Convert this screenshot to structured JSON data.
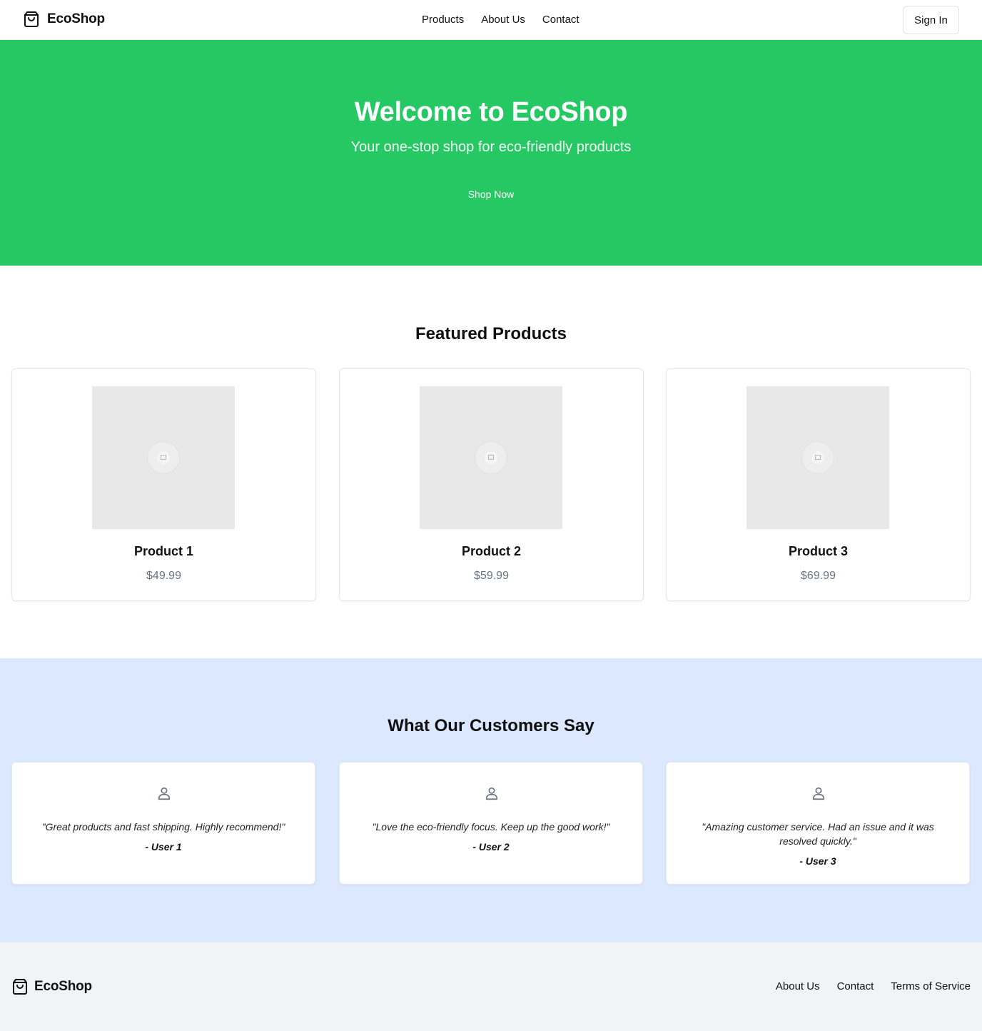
{
  "header": {
    "brand": "EcoShop",
    "brand_icon": "shopping-bag-icon",
    "nav": [
      {
        "label": "Products"
      },
      {
        "label": "About Us"
      },
      {
        "label": "Contact"
      }
    ],
    "sign_in_label": "Sign In"
  },
  "hero": {
    "title": "Welcome to EcoShop",
    "subtitle": "Your one-stop shop for eco-friendly products",
    "cta_label": "Shop Now",
    "background_color": "#25c862"
  },
  "featured": {
    "title": "Featured Products",
    "products": [
      {
        "name": "Product 1",
        "price": "$49.99",
        "image_icon": "broken-image-icon"
      },
      {
        "name": "Product 2",
        "price": "$59.99",
        "image_icon": "broken-image-icon"
      },
      {
        "name": "Product 3",
        "price": "$69.99",
        "image_icon": "broken-image-icon"
      }
    ]
  },
  "testimonials": {
    "title": "What Our Customers Say",
    "background_color": "#dbe8fd",
    "items": [
      {
        "quote": "\"Great products and fast shipping. Highly recommend!\"",
        "author": "- User 1",
        "icon": "user-icon"
      },
      {
        "quote": "\"Love the eco-friendly focus. Keep up the good work!\"",
        "author": "- User 2",
        "icon": "user-icon"
      },
      {
        "quote": "\"Amazing customer service. Had an issue and it was resolved quickly.\"",
        "author": "- User 3",
        "icon": "user-icon"
      }
    ]
  },
  "footer": {
    "brand": "EcoShop",
    "links": [
      {
        "label": "About Us"
      },
      {
        "label": "Contact"
      },
      {
        "label": "Terms of Service"
      }
    ]
  }
}
